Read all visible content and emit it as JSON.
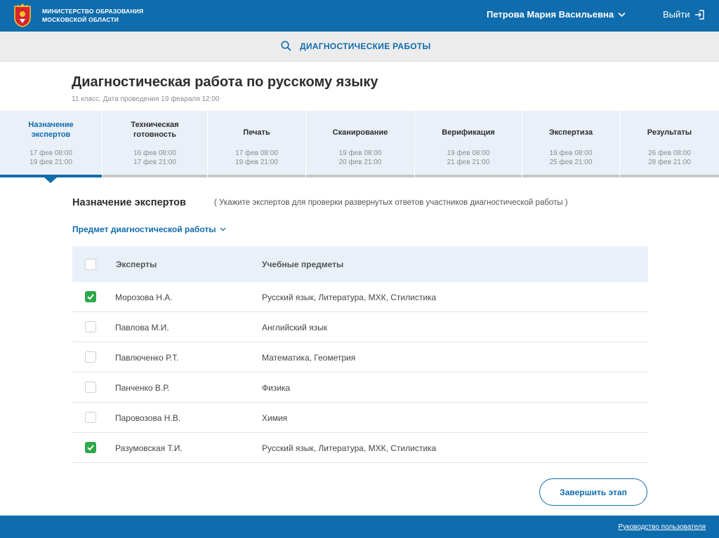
{
  "header": {
    "org_line1": "МИНИСТЕРСТВО ОБРАЗОВАНИЯ",
    "org_line2": "МОСКОВСКОЙ ОБЛАСТИ",
    "user_name": "Петрова Мария Васильевна",
    "logout_label": "Выйти"
  },
  "search": {
    "label": "ДИАГНОСТИЧЕСКИЕ РАБОТЫ"
  },
  "page": {
    "title": "Диагностическая работа по русскому языку",
    "subtitle": "11 класс. Дата проведения 19 февраля 12:00"
  },
  "stepper": [
    {
      "line1": "Назначение",
      "line2": "экспертов",
      "d1": "17 фев 08:00",
      "d2": "19 фев 21:00"
    },
    {
      "line1": "Техническая",
      "line2": "готовность",
      "d1": "16 фев 08:00",
      "d2": "17 фев 21:00"
    },
    {
      "line1": "Печать",
      "line2": "",
      "d1": "17 фев 08:00",
      "d2": "19 фев 21:00"
    },
    {
      "line1": "Сканирование",
      "line2": "",
      "d1": "19 фев 08:00",
      "d2": "20 фев 21:00"
    },
    {
      "line1": "Верификация",
      "line2": "",
      "d1": "19 фев 08:00",
      "d2": "21 фев 21:00"
    },
    {
      "line1": "Экспертиза",
      "line2": "",
      "d1": "19 фев  08:00",
      "d2": "25 фев 21:00"
    },
    {
      "line1": "Результаты",
      "line2": "",
      "d1": "26 фев  08:00",
      "d2": "28 фев 21:00"
    }
  ],
  "section": {
    "title": "Назначение экспертов",
    "hint": "( Укажите экспертов для проверки развернутых ответов участников диагностической работы )",
    "subject_dropdown": "Предмет диагностической работы"
  },
  "table": {
    "col_experts": "Эксперты",
    "col_subjects": "Учебные предметы",
    "rows": [
      {
        "name": "Морозова Н.А.",
        "subjects": "Русский язык, Литература, МХК, Стилистика",
        "checked": true
      },
      {
        "name": "Павлова М.И.",
        "subjects": "Английский язык",
        "checked": false
      },
      {
        "name": "Павлюченко Р.Т.",
        "subjects": "Математика, Геометрия",
        "checked": false
      },
      {
        "name": "Панченко В.Р.",
        "subjects": "Физика",
        "checked": false
      },
      {
        "name": "Паровозова Н.В.",
        "subjects": "Химия",
        "checked": false
      },
      {
        "name": "Разумовская Т.И.",
        "subjects": "Русский язык, Литература, МХК, Стилистика",
        "checked": true
      }
    ]
  },
  "actions": {
    "finish_label": "Завершить этап"
  },
  "footer": {
    "manual_link": "Руководство пользователя"
  },
  "colors": {
    "primary": "#0f6cad",
    "accent_green": "#2ea84a",
    "stepper_bg": "#eaf0f8"
  },
  "icons": {
    "logo": "moscow-region-coat-of-arms-icon",
    "search": "search-icon",
    "user_menu": "chevron-down-icon",
    "logout": "logout-icon",
    "check": "checkmark-icon"
  }
}
